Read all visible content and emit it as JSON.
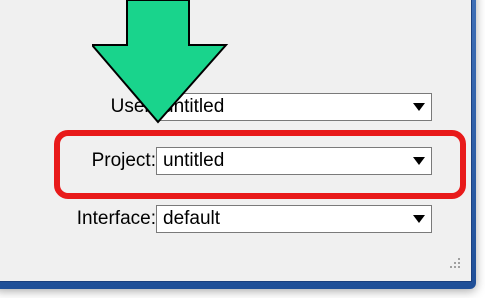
{
  "fields": [
    {
      "label": "User:",
      "value": "untitled"
    },
    {
      "label": "Project:",
      "value": "untitled"
    },
    {
      "label": "Interface:",
      "value": "default"
    }
  ],
  "colors": {
    "highlight": "#e81a1a",
    "arrow_fill": "#19d48c",
    "frame": "#2f5fa8"
  }
}
